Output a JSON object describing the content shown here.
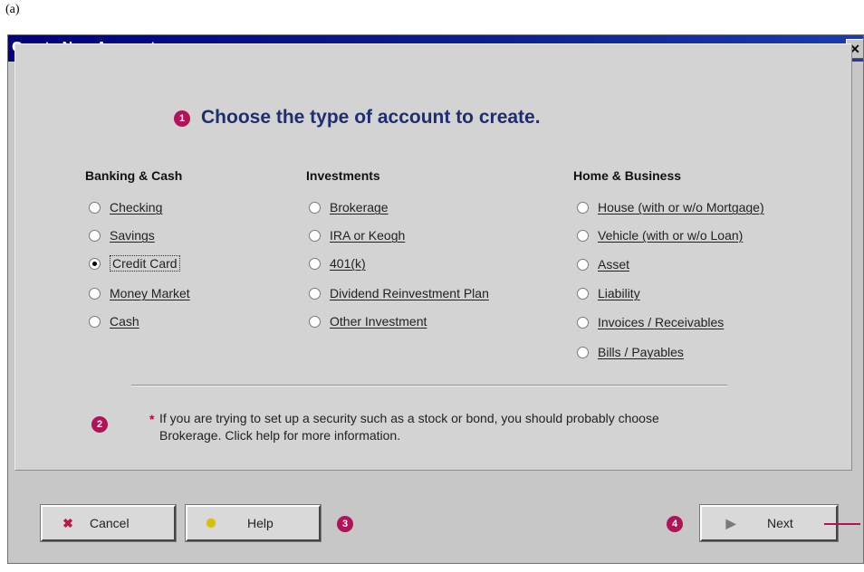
{
  "figure_label": "(a)",
  "window": {
    "title": "Create New Account",
    "close_icon": "close-icon"
  },
  "steps": [
    "1",
    "2",
    "3",
    "4"
  ],
  "heading": "Choose the type of account to create.",
  "columns": [
    {
      "heading": "Banking & Cash",
      "options": [
        {
          "label": "Checking",
          "selected": false
        },
        {
          "label": "Savings",
          "selected": false
        },
        {
          "label": "Credit Card",
          "selected": true
        },
        {
          "label": "Money Market",
          "selected": false
        },
        {
          "label": "Cash",
          "selected": false
        }
      ]
    },
    {
      "heading": "Investments",
      "options": [
        {
          "label": "Brokerage",
          "selected": false
        },
        {
          "label": "IRA or Keogh",
          "selected": false
        },
        {
          "label": "401(k)",
          "selected": false
        },
        {
          "label": "Dividend Reinvestment Plan",
          "selected": false
        },
        {
          "label": "Other Investment",
          "selected": false
        }
      ]
    },
    {
      "heading": "Home & Business",
      "options": [
        {
          "label": "House (with or w/o Mortgage)",
          "selected": false
        },
        {
          "label": "Vehicle (with or w/o Loan)",
          "selected": false
        },
        {
          "label": "Asset",
          "selected": false
        },
        {
          "label": "Liability",
          "selected": false
        },
        {
          "label": "Invoices / Receivables",
          "selected": false
        },
        {
          "label": "Bills / Payables",
          "selected": false
        }
      ]
    }
  ],
  "note": {
    "marker": "*",
    "text": "If you are trying to set up a security such as a stock or bond, you should probably choose Brokerage. Click help for more information."
  },
  "buttons": {
    "cancel": {
      "label": "Cancel",
      "icon": "x-icon"
    },
    "help": {
      "label": "Help",
      "icon": "help-icon"
    },
    "next": {
      "label": "Next",
      "icon": "arrow-right-icon"
    }
  },
  "colors": {
    "titlebar": "#000080",
    "step_marker": "#b01357",
    "heading": "#1e2e6e",
    "cancel_icon": "#c0153a",
    "help_icon": "#d8c000"
  }
}
